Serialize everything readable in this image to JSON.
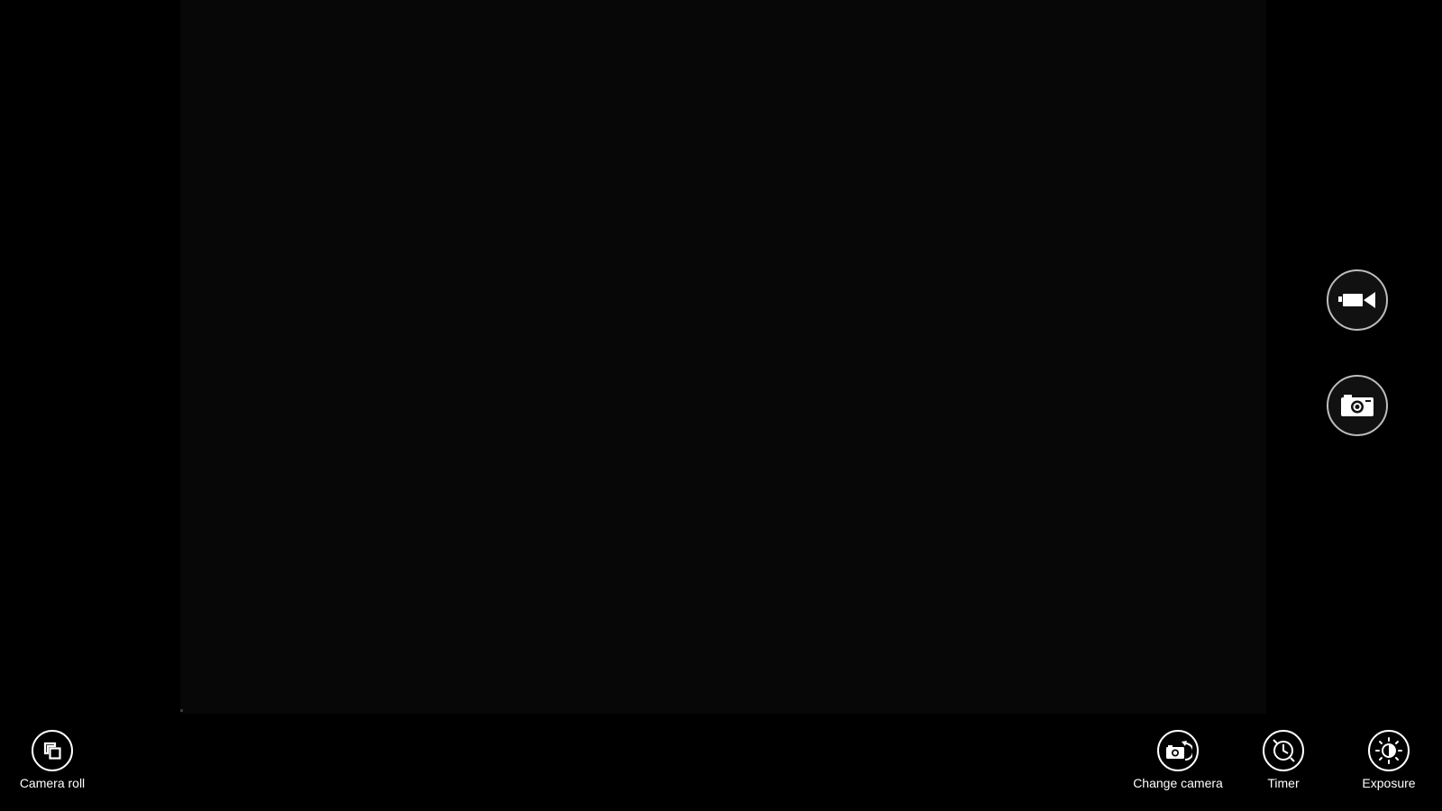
{
  "viewfinder": {
    "background": "#070707"
  },
  "capture": {
    "video_icon": "video-camera-icon",
    "photo_icon": "camera-icon"
  },
  "appbar": {
    "left": [
      {
        "label": "Camera roll",
        "icon": "camera-roll-icon"
      }
    ],
    "right": [
      {
        "label": "Change camera",
        "icon": "change-camera-icon"
      },
      {
        "label": "Timer",
        "icon": "timer-icon"
      },
      {
        "label": "Exposure",
        "icon": "exposure-icon"
      }
    ]
  },
  "colors": {
    "background": "#000000",
    "foreground": "#ffffff",
    "button_border": "#bdbdbd"
  }
}
